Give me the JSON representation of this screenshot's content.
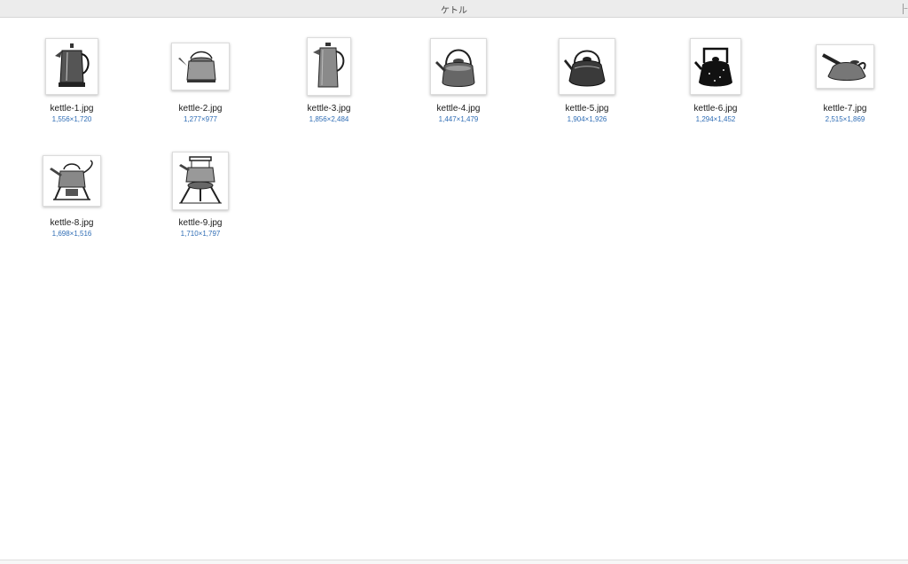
{
  "window": {
    "title": "ケトル"
  },
  "files": [
    {
      "name": "kettle-1.jpg",
      "dims": "1,556×1,720",
      "icon": "kettle-1-thumbnail"
    },
    {
      "name": "kettle-2.jpg",
      "dims": "1,277×977",
      "icon": "kettle-2-thumbnail"
    },
    {
      "name": "kettle-3.jpg",
      "dims": "1,856×2,484",
      "icon": "kettle-3-thumbnail"
    },
    {
      "name": "kettle-4.jpg",
      "dims": "1,447×1,479",
      "icon": "kettle-4-thumbnail"
    },
    {
      "name": "kettle-5.jpg",
      "dims": "1,904×1,926",
      "icon": "kettle-5-thumbnail"
    },
    {
      "name": "kettle-6.jpg",
      "dims": "1,294×1,452",
      "icon": "kettle-6-thumbnail"
    },
    {
      "name": "kettle-7.jpg",
      "dims": "2,515×1,869",
      "icon": "kettle-7-thumbnail"
    },
    {
      "name": "kettle-8.jpg",
      "dims": "1,698×1,516",
      "icon": "kettle-8-thumbnail"
    },
    {
      "name": "kettle-9.jpg",
      "dims": "1,710×1,797",
      "icon": "kettle-9-thumbnail"
    }
  ],
  "colors": {
    "dims_text": "#2f6db5",
    "name_text": "#1a1a1a",
    "titlebar": "#ececec"
  }
}
